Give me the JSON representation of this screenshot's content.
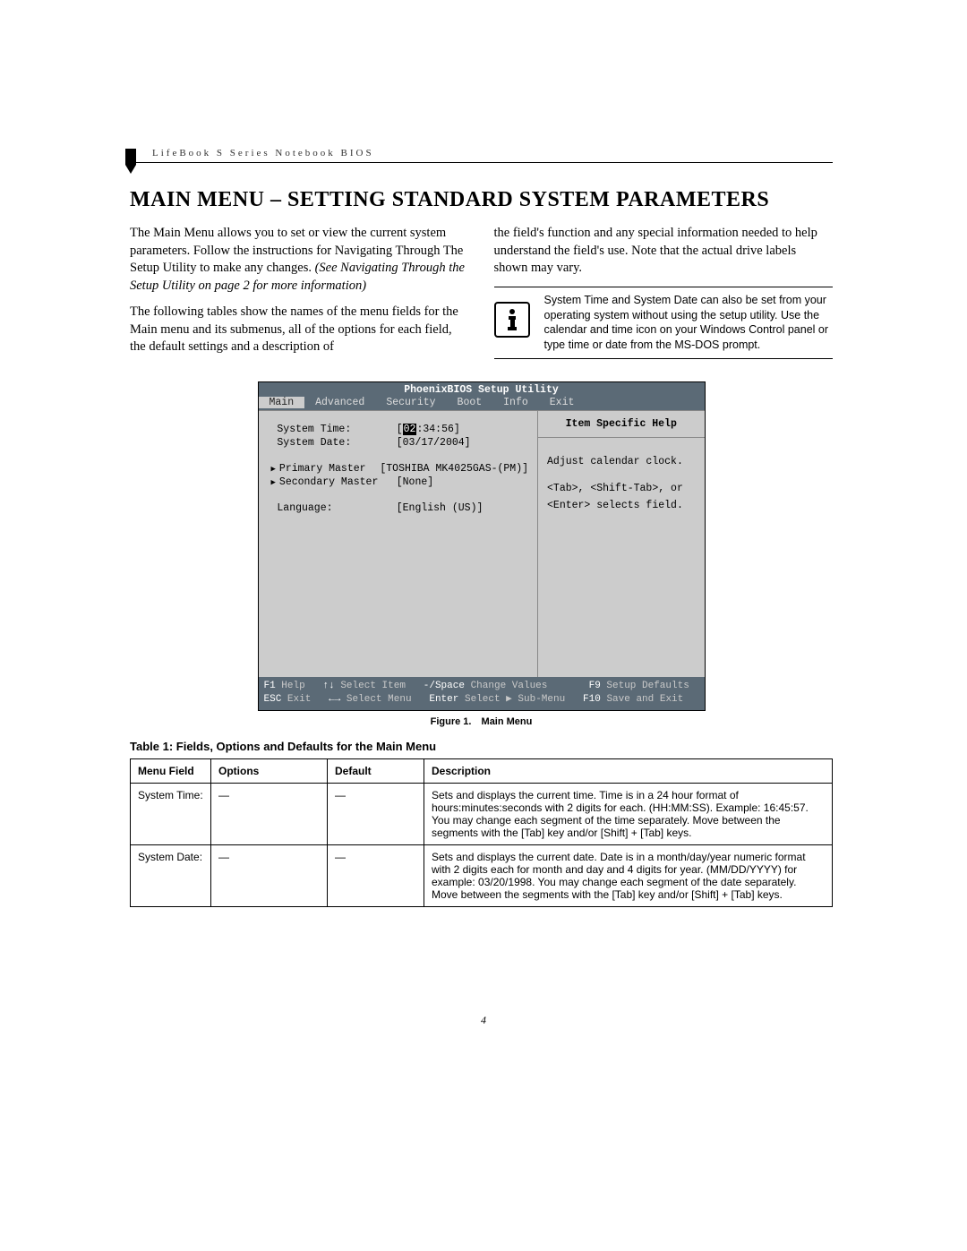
{
  "header": {
    "line": "LifeBook S Series Notebook BIOS"
  },
  "title": "MAIN MENU – SETTING STANDARD SYSTEM PARAMETERS",
  "col_left": {
    "p1": "The Main Menu allows you to set or view the current system parameters. Follow the instructions for Navigating Through The Setup Utility to make any changes.",
    "p1_italic": "(See Navigating Through the Setup Utility on page 2 for more information)",
    "p2": "The following tables show the names of the menu fields for the Main menu and its submenus, all of the options for each field, the default settings and a description of "
  },
  "col_right": {
    "p1": "the field's function and any special information needed to help understand the field's use. Note that the actual drive labels shown may vary.",
    "note": "System Time and System Date can also be set from your operating system without using the setup utility. Use the calendar and time icon on your Windows Control panel or type time or date from the MS-DOS prompt."
  },
  "bios": {
    "title": "PhoenixBIOS Setup Utility",
    "tabs": [
      "Main",
      "Advanced",
      "Security",
      "Boot",
      "Info",
      "Exit"
    ],
    "active_tab": "Main",
    "rows": [
      {
        "label": "System Time:",
        "value_prefix": "[",
        "hl": "02",
        "value_suffix": ":34:56]"
      },
      {
        "label": "System Date:",
        "value": "[03/17/2004]"
      },
      {
        "spacer": true
      },
      {
        "label": "Primary Master",
        "tri": true,
        "value": "[TOSHIBA MK4025GAS-(PM)]"
      },
      {
        "label": "Secondary Master",
        "tri": true,
        "value": "[None]"
      },
      {
        "spacer": true
      },
      {
        "label": "Language:",
        "value": "[English (US)]"
      }
    ],
    "help_title": "Item Specific Help",
    "help_body_1": "Adjust calendar clock.",
    "help_body_2": "<Tab>, <Shift-Tab>, or <Enter> selects field.",
    "footer_l1_a": "F1",
    "footer_l1_b": " Help   ",
    "footer_l1_c": "↑↓",
    "footer_l1_d": " Select Item   ",
    "footer_l1_e": "-/Space",
    "footer_l1_f": " Change Values       ",
    "footer_l1_g": "F9",
    "footer_l1_h": " Setup Defaults",
    "footer_l2_a": "ESC",
    "footer_l2_b": " Exit   ",
    "footer_l2_c": "←→",
    "footer_l2_d": " Select Menu   ",
    "footer_l2_e": "Enter",
    "footer_l2_f": " Select ▶ Sub-Menu   ",
    "footer_l2_g": "F10",
    "footer_l2_h": " Save and Exit"
  },
  "fig_caption": {
    "num": "Figure 1.",
    "text": "Main Menu"
  },
  "table_title": "Table 1: Fields, Options and Defaults for the Main Menu",
  "table": {
    "headers": [
      "Menu Field",
      "Options",
      "Default",
      "Description"
    ],
    "rows": [
      {
        "field": "System Time:",
        "options": "—",
        "default": "—",
        "desc": "Sets and displays the current time. Time is in a 24 hour format of hours:minutes:seconds with 2 digits for each. (HH:MM:SS). Example: 16:45:57. You may change each segment of the time separately. Move between the segments with the [Tab] key and/or [Shift] + [Tab] keys."
      },
      {
        "field": "System Date:",
        "options": "—",
        "default": "—",
        "desc": "Sets and displays the current date. Date is in a month/day/year numeric format with 2 digits each for month and day and 4 digits for year. (MM/DD/YYYY) for example: 03/20/1998. You may change each segment of the date separately. Move between the segments with the [Tab] key and/or [Shift] + [Tab] keys."
      }
    ]
  },
  "page_number": "4"
}
